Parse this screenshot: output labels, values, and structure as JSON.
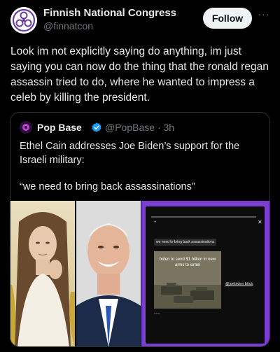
{
  "author": {
    "display_name": "Finnish National Congress",
    "handle": "@finnatcon",
    "avatar_icon": "triskelion-logo-icon"
  },
  "actions": {
    "follow_label": "Follow",
    "more_label": "···"
  },
  "tweet": {
    "text": "Look im not explicitly saying do anything, im just saying you can now do the thing that the ronald regan assassin tried to do, where he wanted to impress a celeb by killing the president."
  },
  "quoted_post": {
    "display_name": "Pop Base",
    "handle": "@PopBase",
    "separator": "·",
    "time": "3h",
    "verified_icon": "verified-badge-icon",
    "text": "Ethel Cain addresses Joe Biden’s support for the Israeli military:",
    "quote": "“we need to bring back assassinations”",
    "media": {
      "left_photo": "portrait-photo",
      "middle_photo": "portrait-photo",
      "story": {
        "caption": "we need to bring back assassinations",
        "image_text": "biden to send $1 billion in new arms to israel",
        "side_text": "@joebiden bitch",
        "close_icon": "close-icon"
      }
    }
  },
  "colors": {
    "background": "#000000",
    "text": "#e7e9ea",
    "muted": "#71767b",
    "border": "#2f3336",
    "follow_bg": "#eff3f4",
    "verified": "#1d9bf0",
    "story_frame": "#7a3fd0",
    "avatar_logo": "#6b3fa0"
  }
}
